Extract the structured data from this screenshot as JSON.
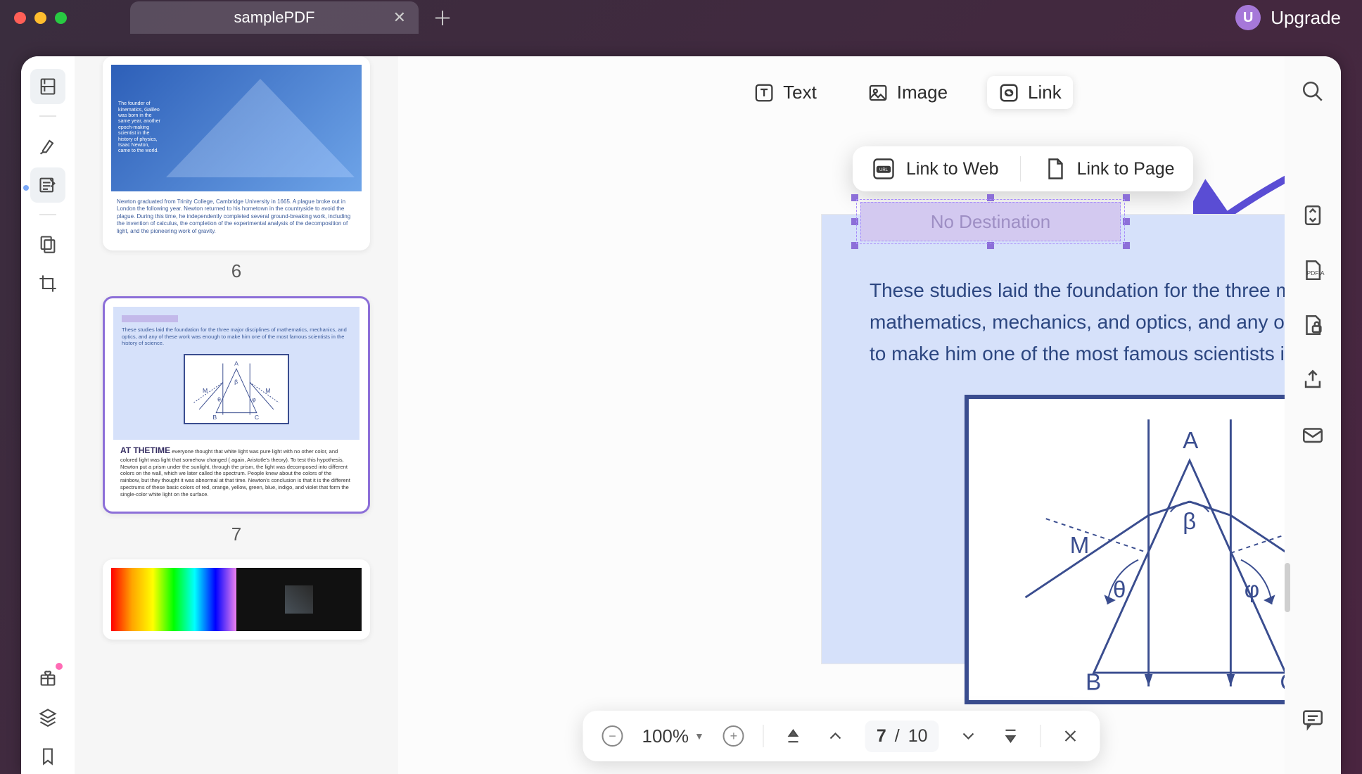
{
  "tab": {
    "title": "samplePDF"
  },
  "upgrade": {
    "avatar_letter": "U",
    "label": "Upgrade"
  },
  "edit_toolbar": {
    "text": "Text",
    "image": "Image",
    "link": "Link"
  },
  "link_popup": {
    "web": "Link to Web",
    "page": "Link to Page"
  },
  "link_box": {
    "placeholder": "No Destination"
  },
  "paragraph": "These studies laid the foundation for the three major disciplines of mathematics, mechanics, and optics, and any of these work was enough to make him one of the most famous scientists in the history of science.",
  "diagram_labels": {
    "A": "A",
    "B": "B",
    "C": "C",
    "M1": "M",
    "M2": "M",
    "beta": "β",
    "theta": "θ",
    "phi": "φ"
  },
  "thumbs": {
    "6": {
      "label": "6",
      "text": "Newton graduated from Trinity College, Cambridge University in 1665. A plague broke out in London the following year. Newton returned to his hometown in the countryside to avoid the plague. During this time, he independently completed several ground-breaking work, including the invention of calculus, the completion of the experimental analysis of the decomposition of light, and the pioneering work of gravity."
    },
    "7": {
      "label": "7",
      "intro": "These studies laid the foundation for the three major disciplines of mathematics, mechanics, and optics, and any of these work was enough to make him one of the most famous scientists in the history of science.",
      "heading": "AT THETIME",
      "body": "everyone thought that white light was pure light with no other color, and colored light was light that somehow changed ( again, Aristotle's theory). To test this hypothesis, Newton put a prism under the sunlight, through the prism, the light was decomposed into different colors on the wall, which we later called the spectrum. People knew about the colors of the rainbow, but they thought it was abnormal at that time. Newton's conclusion is that it is the different spectrums of these basic colors of red, orange, yellow, green, blue, indigo, and violet that form the single-color white light on the surface."
    }
  },
  "zoom": {
    "level": "100%"
  },
  "pager": {
    "current": "7",
    "total": "10",
    "sep": "/"
  }
}
